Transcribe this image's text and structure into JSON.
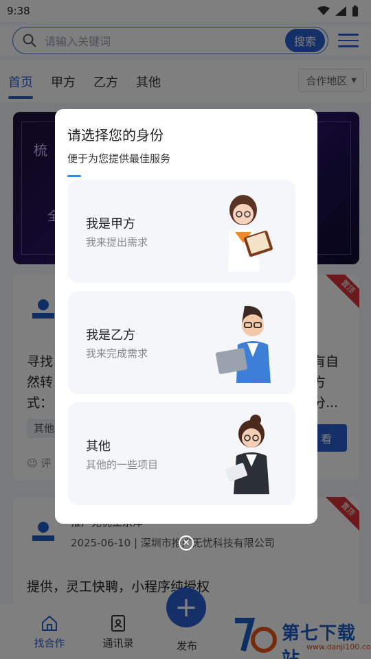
{
  "status_bar": {
    "time": "9:38"
  },
  "search": {
    "placeholder": "请输入关键词",
    "button_label": "搜索"
  },
  "tabs": [
    {
      "label": "首页",
      "active": true
    },
    {
      "label": "甲方",
      "active": false
    },
    {
      "label": "乙方",
      "active": false
    },
    {
      "label": "其他",
      "active": false
    }
  ],
  "region_select": {
    "label": "合作地区"
  },
  "banner": {
    "text_1": "梳",
    "text_2": "全"
  },
  "cards": [
    {
      "ribbon": "置顶",
      "lines": [
        "寻找",
        "然转",
        "式："
      ],
      "right_lines": [
        "有自",
        "方",
        "分..."
      ],
      "tag": "其他",
      "view_label": "看",
      "comment": "评"
    },
    {
      "ribbon": "置顶",
      "title": "推广无忧工京津",
      "date_company": "2025-06-10 | 深圳市推广无忧科技有限公司",
      "line": "提供，灵工快聘，小程序纯授权"
    }
  ],
  "dialog": {
    "title": "请选择您的身份",
    "subtitle": "便于为您提供最佳服务",
    "options": [
      {
        "title": "我是甲方",
        "desc": "我来提出需求",
        "icon": "woman-with-book-avatar"
      },
      {
        "title": "我是乙方",
        "desc": "我来完成需求",
        "icon": "man-with-laptop-avatar"
      },
      {
        "title": "其他",
        "desc": "其他的一些项目",
        "icon": "woman-with-tablet-avatar"
      }
    ]
  },
  "bottom_nav": [
    {
      "label": "找合作",
      "active": true,
      "icon": "home-icon"
    },
    {
      "label": "通讯录",
      "active": false,
      "icon": "contacts-icon"
    },
    {
      "label": "发布",
      "active": false,
      "icon": "plus-icon"
    }
  ],
  "watermark": {
    "main": "第七下载站",
    "url": "www.danji100.com"
  },
  "colors": {
    "accent": "#2a5fd0",
    "ribbon": "#d6333a",
    "overlay": "rgba(0,0,0,0.5)"
  }
}
